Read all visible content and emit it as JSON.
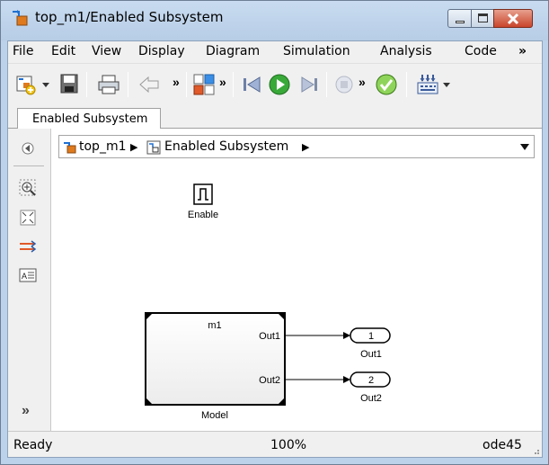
{
  "window": {
    "title": "top_m1/Enabled Subsystem"
  },
  "menu": [
    "File",
    "Edit",
    "View",
    "Display",
    "Diagram",
    "Simulation",
    "Analysis",
    "Code",
    "»"
  ],
  "toolbar": {
    "overflow_label": "»",
    "icons": [
      "new-model-icon",
      "save-icon",
      "print-icon",
      "back-icon",
      "library-browser-icon",
      "step-back-icon",
      "run-icon",
      "step-forward-icon",
      "stop-icon",
      "model-advisor-check-icon",
      "build-icon"
    ]
  },
  "tab": {
    "label": "Enabled Subsystem"
  },
  "address": {
    "root": "top_m1",
    "current": "Enabled Subsystem",
    "separator": "▶"
  },
  "palette": {
    "more_label": "»",
    "icons": [
      "hide-browser-icon",
      "zoom-icon",
      "fit-to-view-icon",
      "signal-routing-icon",
      "annotation-icon"
    ]
  },
  "diagram": {
    "enable_block_label": "Enable",
    "model_block_name": "m1",
    "model_block_caption": "Model",
    "model_ports": [
      "Out1",
      "Out2"
    ],
    "outports": [
      {
        "number": "1",
        "label": "Out1"
      },
      {
        "number": "2",
        "label": "Out2"
      }
    ]
  },
  "status": {
    "left": "Ready",
    "zoom": "100%",
    "solver": "ode45"
  },
  "colors": {
    "run_green": "#39a93a",
    "close_red": "#c9452b",
    "title_blue": "#bcd2ea"
  }
}
